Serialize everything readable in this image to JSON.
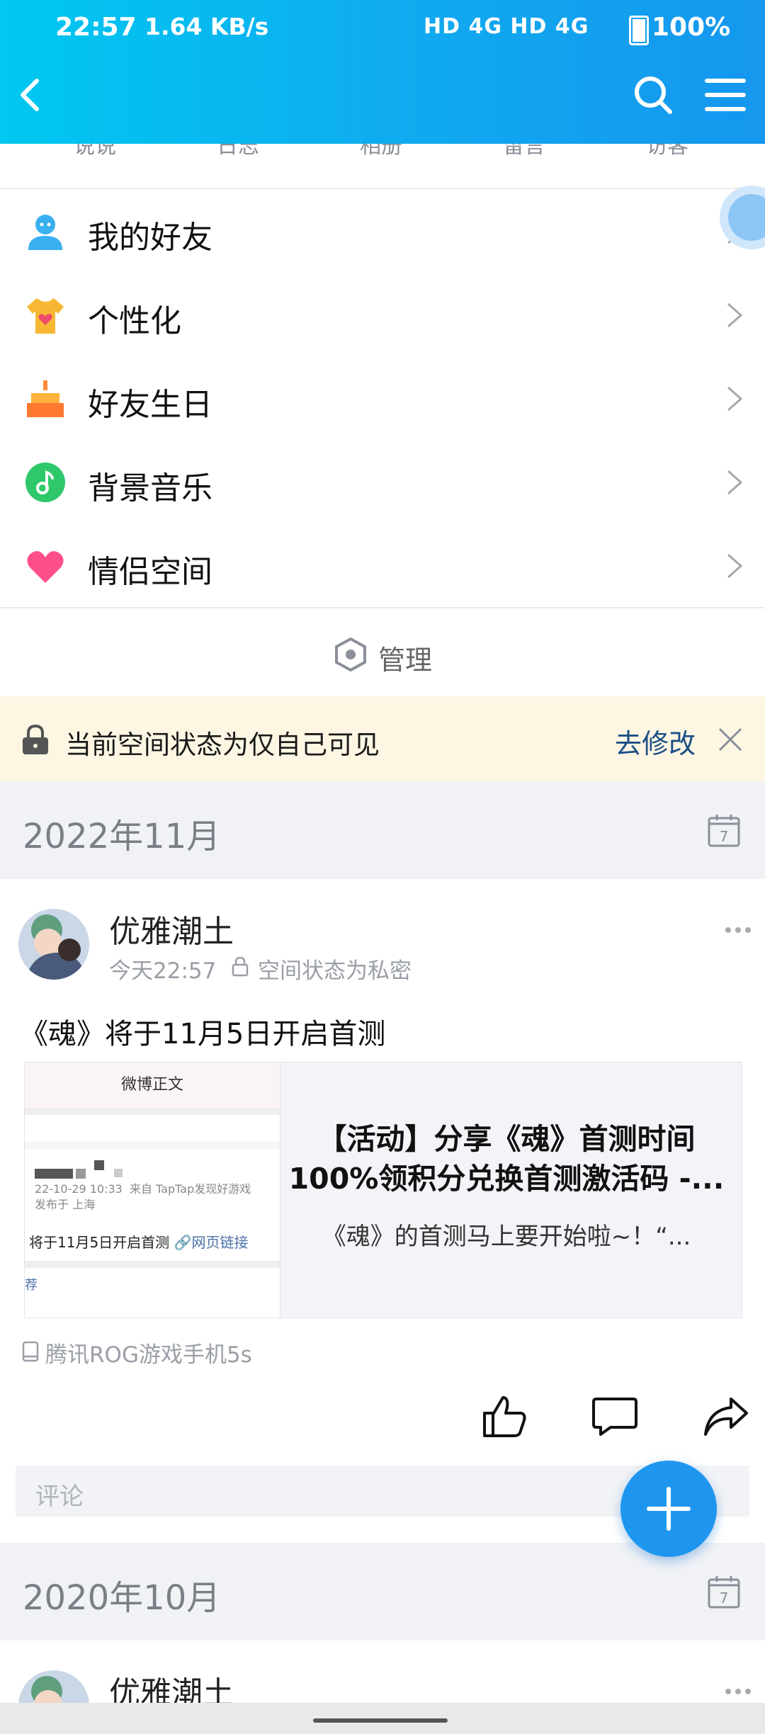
{
  "status_bar": {
    "time": "22:57",
    "speed": "1.64 KB/s",
    "network": "HD 4G HD 4G",
    "battery": "100%"
  },
  "tabs": [
    "说说",
    "日志",
    "相册",
    "留言",
    "访客"
  ],
  "menu": [
    {
      "label": "我的好友",
      "icon": "friends-icon"
    },
    {
      "label": "个性化",
      "icon": "tshirt-icon"
    },
    {
      "label": "好友生日",
      "icon": "cake-icon"
    },
    {
      "label": "背景音乐",
      "icon": "music-icon"
    },
    {
      "label": "情侣空间",
      "icon": "heart-icon"
    }
  ],
  "manage_label": "管理",
  "notice": {
    "text": "当前空间状态为仅自己可见",
    "action": "去修改"
  },
  "sections": [
    {
      "month": "2022年11月"
    },
    {
      "month": "2020年10月"
    }
  ],
  "post": {
    "author": "优雅潮土",
    "time": "今天22:57",
    "privacy": "空间状态为私密",
    "content": "《魂》将于11月5日开启首测",
    "card": {
      "title": "【活动】分享《魂》首测时间100%领积分兑换首测激活码 -...",
      "desc": "《魂》的首测马上要开始啦~！“...",
      "thumb_header": "微博正文",
      "thumb_meta": "22-10-29 10:33  来自 TapTap发现好游戏\n发布于 上海",
      "thumb_body": "将于11月5日开启首测",
      "thumb_link": "网页链接",
      "thumb_rec": "荐"
    },
    "device": "腾讯ROG游戏手机5s",
    "comment_placeholder": "评论"
  },
  "post2": {
    "author": "优雅潮土"
  },
  "colors": {
    "header_start": "#00c8f0",
    "header_end": "#1597ee",
    "link_blue": "#1b4f86",
    "fab": "#1e96f0",
    "notice_bg": "#fdf6e3"
  }
}
